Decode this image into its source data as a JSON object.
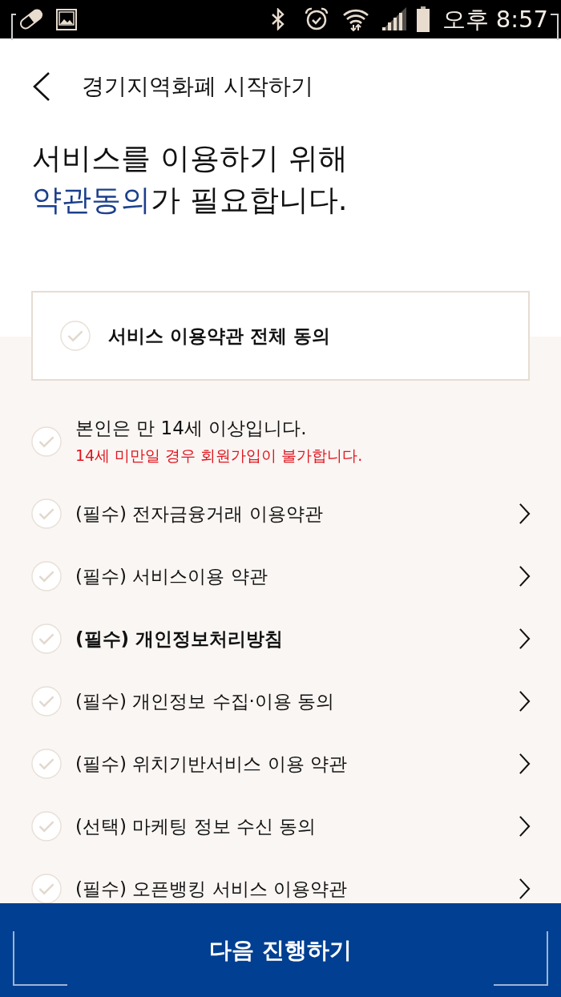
{
  "status_bar": {
    "time": "오후 8:57"
  },
  "header": {
    "title": "경기지역화폐 시작하기"
  },
  "headline": {
    "text_1": "서비스를 이용하기 위해",
    "highlight": "약관동의",
    "text_2": "가 필요합니다."
  },
  "agree_all": {
    "label": "서비스 이용약관 전체 동의",
    "checked": false
  },
  "terms": [
    {
      "kind": "notice",
      "label": "본인은 만 14세 이상입니다.",
      "note": "14세 미만일 경우 회원가입이 불가합니다.",
      "checked": false,
      "bold": false
    },
    {
      "kind": "link",
      "label": "(필수) 전자금융거래 이용약관",
      "checked": false,
      "bold": false
    },
    {
      "kind": "link",
      "label": "(필수) 서비스이용 약관",
      "checked": false,
      "bold": false
    },
    {
      "kind": "link",
      "label": "(필수) 개인정보처리방침",
      "checked": false,
      "bold": true
    },
    {
      "kind": "link",
      "label": "(필수) 개인정보 수집·이용 동의",
      "checked": false,
      "bold": false
    },
    {
      "kind": "link",
      "label": "(필수) 위치기반서비스 이용 약관",
      "checked": false,
      "bold": false
    },
    {
      "kind": "link",
      "label": "(선택) 마케팅 정보 수신 동의",
      "checked": false,
      "bold": false
    },
    {
      "kind": "link",
      "label": "(필수) 오픈뱅킹 서비스 이용약관",
      "checked": false,
      "bold": false
    }
  ],
  "next_button": {
    "label": "다음 진행하기"
  }
}
